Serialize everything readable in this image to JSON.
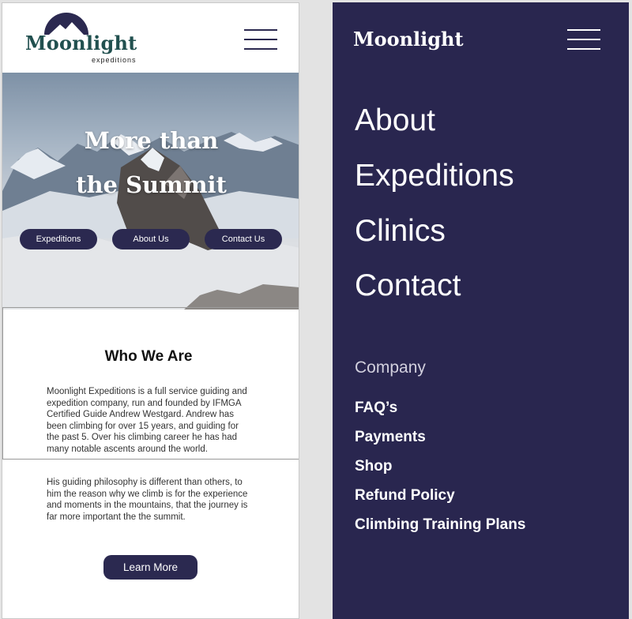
{
  "left_screen": {
    "logo": {
      "name": "Moonlight",
      "tagline": "expeditions"
    },
    "hero": {
      "title_line1": "More than",
      "title_line2": "the Summit",
      "buttons": [
        "Expeditions",
        "About Us",
        "Contact Us"
      ]
    },
    "who": {
      "title": "Who We Are",
      "paragraph1": "Moonlight Expeditions is a full service guiding and expedition company, run and founded by IFMGA Certified Guide Andrew Westgard. Andrew has been climbing for over 15 years, and guiding for the past 5. Over his climbing career he has had many notable ascents around the world.",
      "paragraph2": "His guiding philosophy is different than others, to him the reason why we climb is for the experience and moments in the mountains, that the journey is far more important the the summit.",
      "cta": "Learn More"
    }
  },
  "right_screen": {
    "logo": "Moonlight",
    "nav": [
      "About",
      "Expeditions",
      "Clinics",
      "Contact"
    ],
    "company_heading": "Company",
    "company_links": [
      "FAQ’s",
      "Payments",
      "Shop",
      "Refund Policy",
      "Climbing Training Plans"
    ]
  },
  "colors": {
    "brand_navy": "#2b2950",
    "menu_bg": "#29264f",
    "logo_teal": "#21504f",
    "page_bg": "#e3e3e3"
  },
  "icons": [
    "moon-logo-icon",
    "hamburger-menu-icon"
  ]
}
